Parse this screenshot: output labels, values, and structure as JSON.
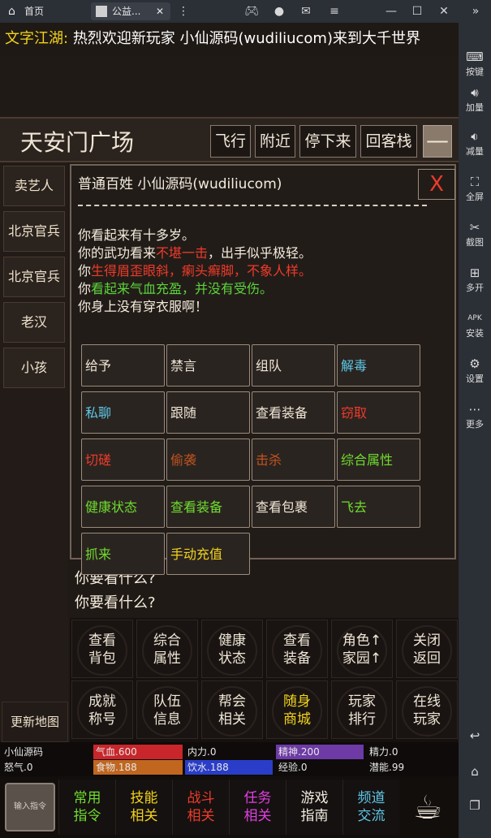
{
  "topbar": {
    "tab_home": "首页",
    "tab_game": "公益...",
    "icons": [
      "home-icon",
      "gamepad-icon",
      "user-icon",
      "mail-icon",
      "menu-icon",
      "minimize-icon",
      "maximize-icon",
      "close-icon"
    ]
  },
  "rightbar": {
    "items": [
      {
        "label": "按键",
        "icon": "keyboard-icon"
      },
      {
        "label": "加量",
        "icon": "volume-up-icon"
      },
      {
        "label": "减量",
        "icon": "volume-down-icon"
      },
      {
        "label": "全屏",
        "icon": "fullscreen-icon"
      },
      {
        "label": "截图",
        "icon": "scissors-icon"
      },
      {
        "label": "多开",
        "icon": "multi-open-icon"
      },
      {
        "label": "安装",
        "icon": "apk-icon"
      },
      {
        "label": "设置",
        "icon": "gear-icon"
      },
      {
        "label": "更多",
        "icon": "more-icon"
      }
    ]
  },
  "broadcast": {
    "channel": "文字江湖:",
    "text": "热烈欢迎新玩家 小仙源码(wudiliucom)来到大千世界"
  },
  "location": {
    "title": "天安门广场",
    "buttons": [
      "飞行",
      "附近",
      "停下来",
      "回客栈"
    ],
    "minus": "—"
  },
  "npcs": [
    "卖艺人",
    "北京官兵",
    "北京官兵",
    "老汉",
    "小孩"
  ],
  "update_map": "更新地图",
  "panel": {
    "header": "普通百姓 小仙源码(wudiliucom)",
    "close": "X",
    "lines": [
      {
        "parts": [
          {
            "t": "你看起来有十多岁。",
            "c": ""
          }
        ]
      },
      {
        "parts": [
          {
            "t": "你的武功看来",
            "c": ""
          },
          {
            "t": "不堪一击",
            "c": "red"
          },
          {
            "t": "，出手似乎极轻。",
            "c": ""
          }
        ]
      },
      {
        "parts": [
          {
            "t": "你",
            "c": ""
          },
          {
            "t": "生得眉歪眼斜，瘌头癣脚，不象人样。",
            "c": "red"
          }
        ]
      },
      {
        "parts": [
          {
            "t": "你",
            "c": ""
          },
          {
            "t": "看起来气血充盈，并没有受伤。",
            "c": "green"
          }
        ]
      },
      {
        "parts": [
          {
            "t": "你身上没有穿衣服啊！",
            "c": ""
          }
        ]
      }
    ],
    "actions": [
      {
        "label": "给予",
        "color": "white"
      },
      {
        "label": "禁言",
        "color": "white"
      },
      {
        "label": "组队",
        "color": "white"
      },
      {
        "label": "解毒",
        "color": "cyan"
      },
      {
        "label": "私聊",
        "color": "cyan"
      },
      {
        "label": "跟随",
        "color": "white"
      },
      {
        "label": "查看装备",
        "color": "white"
      },
      {
        "label": "窃取",
        "color": "red"
      },
      {
        "label": "切磋",
        "color": "red"
      },
      {
        "label": "偷袭",
        "color": "brown"
      },
      {
        "label": "击杀",
        "color": "brown"
      },
      {
        "label": "综合属性",
        "color": "green"
      },
      {
        "label": "健康状态",
        "color": "green"
      },
      {
        "label": "查看装备",
        "color": "green"
      },
      {
        "label": "查看包裹",
        "color": "white"
      },
      {
        "label": "飞去",
        "color": "green"
      },
      {
        "label": "抓来",
        "color": "green"
      },
      {
        "label": "手动充值",
        "color": "yellow"
      }
    ]
  },
  "log": [
    "你要看什么?",
    "你要看什么?"
  ],
  "menu_row1": [
    {
      "l1": "查看",
      "l2": "背包",
      "color": "white"
    },
    {
      "l1": "综合",
      "l2": "属性",
      "color": "white"
    },
    {
      "l1": "健康",
      "l2": "状态",
      "color": "white"
    },
    {
      "l1": "查看",
      "l2": "装备",
      "color": "white"
    },
    {
      "l1": "角色↑",
      "l2": "家园↑",
      "color": "white"
    },
    {
      "l1": "关闭",
      "l2": "返回",
      "color": "white"
    }
  ],
  "menu_row2": [
    {
      "l1": "成就",
      "l2": "称号",
      "color": "white"
    },
    {
      "l1": "队伍",
      "l2": "信息",
      "color": "white"
    },
    {
      "l1": "帮会",
      "l2": "相关",
      "color": "white"
    },
    {
      "l1": "随身",
      "l2": "商城",
      "color": "yellow"
    },
    {
      "l1": "玩家",
      "l2": "排行",
      "color": "white"
    },
    {
      "l1": "在线",
      "l2": "玩家",
      "color": "white"
    }
  ],
  "stats": {
    "name": "小仙源码",
    "rage": "怒气.0",
    "row1": [
      {
        "label": "气血.600",
        "bg": "#c8262a"
      },
      {
        "label": "内力.0",
        "bg": ""
      },
      {
        "label": "精神.200",
        "bg": "#6d3aa6"
      },
      {
        "label": "精力.0",
        "bg": ""
      }
    ],
    "row2": [
      {
        "label": "食物.188",
        "bg": "#c0661f"
      },
      {
        "label": "饮水.188",
        "bg": "#2a3dc8"
      },
      {
        "label": "经验.0",
        "bg": ""
      },
      {
        "label": "潜能.99",
        "bg": ""
      }
    ]
  },
  "footer": {
    "input_label": "输入指令",
    "buttons": [
      {
        "l1": "常用",
        "l2": "指令",
        "color": "#6fdc2e"
      },
      {
        "l1": "技能",
        "l2": "相关",
        "color": "#f2d31c"
      },
      {
        "l1": "战斗",
        "l2": "相关",
        "color": "#ee3b2b"
      },
      {
        "l1": "任务",
        "l2": "相关",
        "color": "#e040e0"
      },
      {
        "l1": "游戏",
        "l2": "指南",
        "color": "#f3ebdd"
      },
      {
        "l1": "频道",
        "l2": "交流",
        "color": "#5ec8e8"
      }
    ]
  }
}
